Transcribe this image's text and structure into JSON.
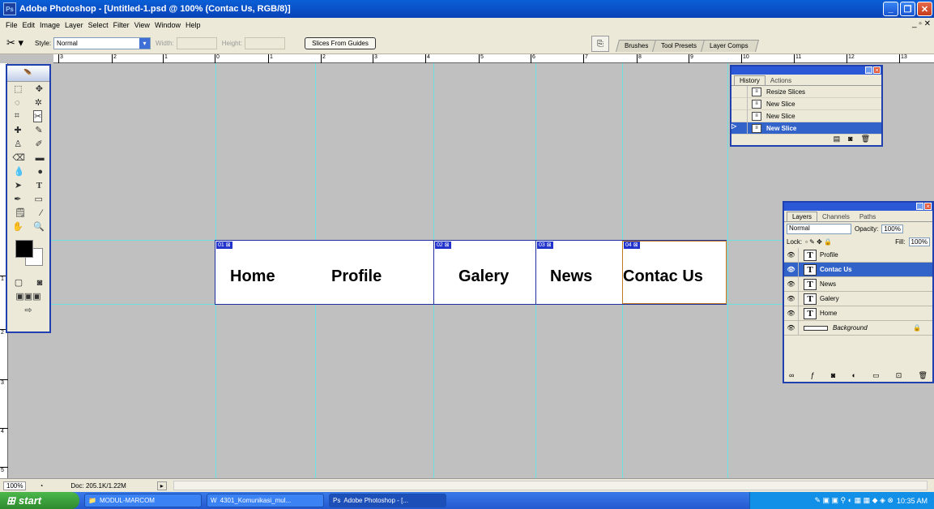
{
  "window": {
    "title": "Adobe Photoshop - [Untitled-1.psd @ 100% (Contac Us, RGB/8)]",
    "controls": [
      "_",
      "❐",
      "✕"
    ]
  },
  "menu": [
    "File",
    "Edit",
    "Image",
    "Layer",
    "Select",
    "Filter",
    "View",
    "Window",
    "Help"
  ],
  "options": {
    "style_label": "Style:",
    "style_value": "Normal",
    "width_label": "Width:",
    "height_label": "Height:",
    "slices_button": "Slices From Guides"
  },
  "palette_well_tabs": [
    "Brushes",
    "Tool Presets",
    "Layer Comps"
  ],
  "ruler_h": [
    "3",
    "2",
    "1",
    "0",
    "1",
    "2",
    "3",
    "4",
    "5",
    "6",
    "7",
    "8",
    "9",
    "10",
    "11",
    "12",
    "13"
  ],
  "ruler_v": [
    "1",
    "2",
    "3",
    "4",
    "5"
  ],
  "slices": [
    {
      "badge": "01 ⊠",
      "label": "Home"
    },
    {
      "badge": "",
      "label": "Profile"
    },
    {
      "badge": "02 ⊠",
      "label": "Galery"
    },
    {
      "badge": "03 ⊠",
      "label": "News"
    },
    {
      "badge": "04 ⊠",
      "label": "Contac Us"
    }
  ],
  "history": {
    "tabs": [
      "History",
      "Actions"
    ],
    "items": [
      "Resize Slices",
      "New Slice",
      "New Slice",
      "New Slice"
    ],
    "active_index": 3
  },
  "layers": {
    "tabs": [
      "Layers",
      "Channels",
      "Paths"
    ],
    "blend_mode": "Normal",
    "opacity_label": "Opacity:",
    "opacity_value": "100%",
    "lock_label": "Lock:",
    "fill_label": "Fill:",
    "fill_value": "100%",
    "items": [
      "Profile",
      "Contac Us",
      "News",
      "Galery",
      "Home",
      "Background"
    ],
    "active_index": 1
  },
  "status": {
    "zoom": "100%",
    "doc": "Doc: 205.1K/1.22M"
  },
  "taskbar": {
    "start": "start",
    "tasks": [
      "MODUL-MARCOM",
      "4301_Komunikasi_mul...",
      "Adobe Photoshop - [..."
    ],
    "clock": "10:35 AM"
  },
  "colors": {
    "titlebar": "#0a5fd6",
    "selection": "#3163c8",
    "guide": "#6ee0e0",
    "slice_border": "#2030a0"
  }
}
